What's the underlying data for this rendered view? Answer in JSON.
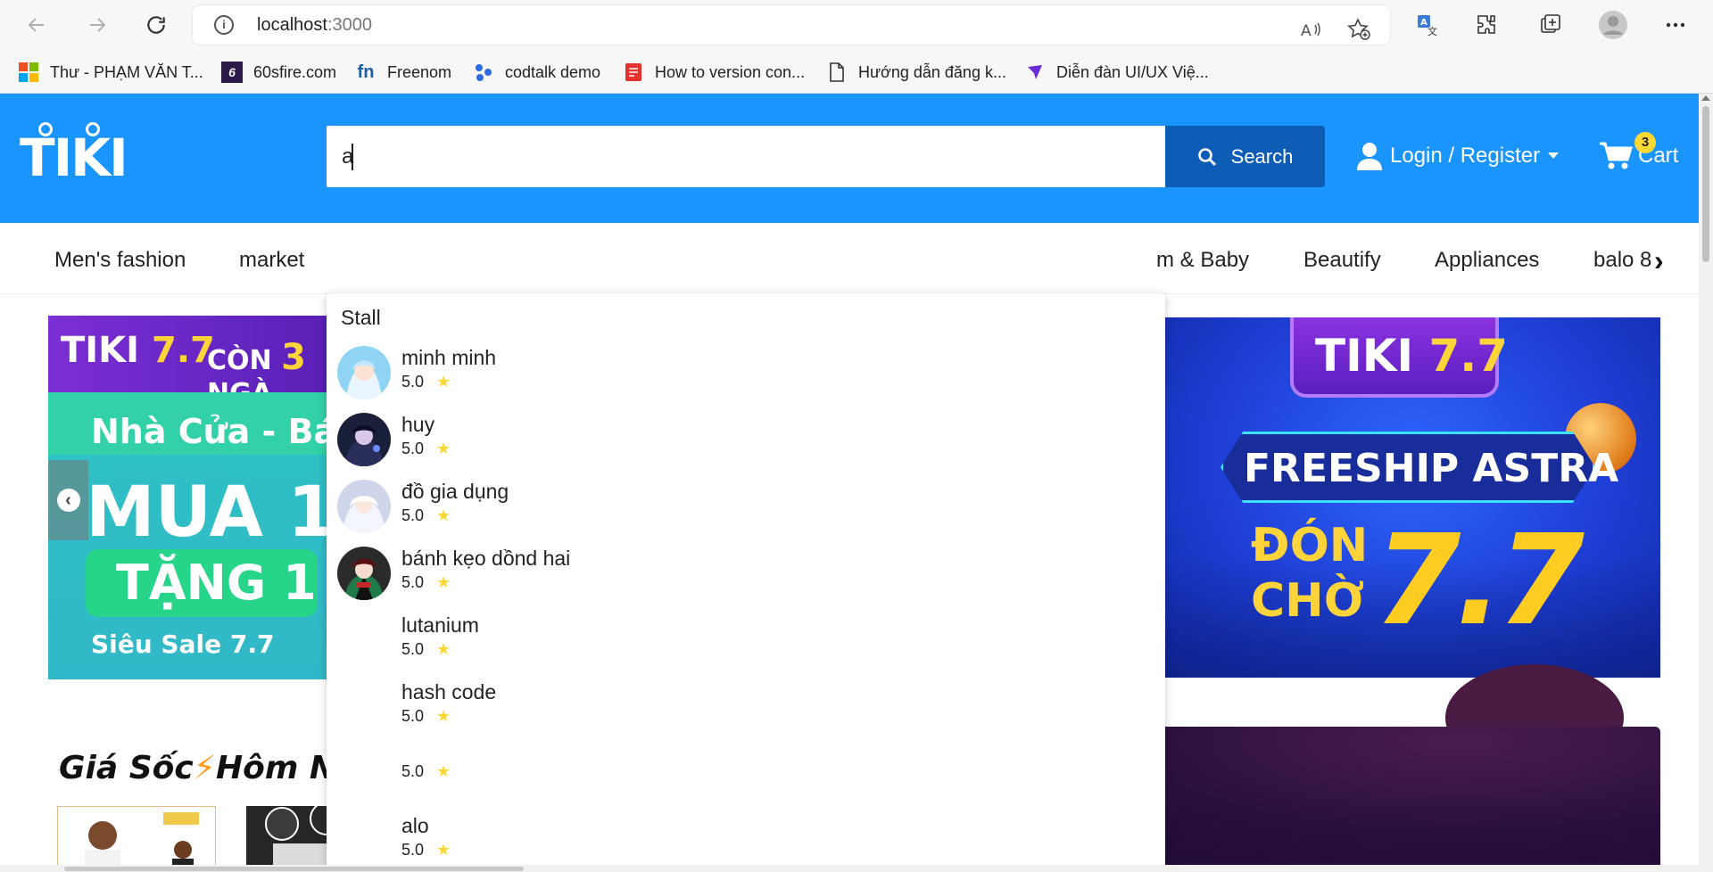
{
  "browser": {
    "url_host": "localhost",
    "url_port": ":3000",
    "icons": [
      "back-icon",
      "forward-icon",
      "refresh-icon",
      "info-icon",
      "read-aloud-icon",
      "add-favorite-icon",
      "translate-icon",
      "extensions-icon",
      "collections-icon",
      "profile-icon",
      "more-icon"
    ],
    "bookmarks": [
      {
        "label": "Thư - PHẠM VĂN T...",
        "icon": "microsoft-icon"
      },
      {
        "label": "60sfire.com",
        "icon": "60sfire-icon"
      },
      {
        "label": "Freenom",
        "icon": "freenom-icon"
      },
      {
        "label": "codtalk demo",
        "icon": "codtalk-icon"
      },
      {
        "label": "How to version con...",
        "icon": "pdf-icon"
      },
      {
        "label": "Hướng dẫn đăng k...",
        "icon": "document-icon"
      },
      {
        "label": "Diễn đàn UI/UX Việ...",
        "icon": "forum-icon"
      }
    ]
  },
  "header": {
    "logo": "TIKI",
    "search_value": "a",
    "search_button": "Search",
    "login_label": "Login / Register",
    "cart_label": "Cart",
    "cart_count": "3",
    "brand_color": "#1a94ff",
    "search_button_color": "#0d5cb6"
  },
  "categories": [
    "Men's fashion",
    "market",
    "m & Baby",
    "Beautify",
    "Appliances",
    "balo 8"
  ],
  "banners": {
    "left": {
      "logo_part1": "TIKI",
      "logo_part2": "7.7",
      "countdown_prefix": "CÒN",
      "countdown_number": "3",
      "countdown_suffix": "NGÀ",
      "line1": "Nhà Cửa - Bách",
      "line2": "MUA 1",
      "line3": "TẶNG 1",
      "line4": "Siêu Sale 7.7"
    },
    "right": {
      "logo_part1": "TIKI",
      "logo_part2": "7.7",
      "ribbon": "FREESHIP ASTRA",
      "line1": "ĐÓN",
      "line2": "CHỜ",
      "big": "7.7"
    }
  },
  "deals": {
    "title_part1": "Giá Sốc",
    "title_bolt": "⚡",
    "title_part2": "Hôm Na"
  },
  "dropdown": {
    "heading": "Stall",
    "items": [
      {
        "name": "minh minh",
        "rating": "5.0",
        "avatar": "anime-girl-blue"
      },
      {
        "name": "huy",
        "rating": "5.0",
        "avatar": "anime-boy-dark"
      },
      {
        "name": "đồ gia dụng",
        "rating": "5.0",
        "avatar": "anime-girl-white"
      },
      {
        "name": "bánh kẹo dồnd hai",
        "rating": "5.0",
        "avatar": "anime-boy-red"
      },
      {
        "name": "lutanium",
        "rating": "5.0",
        "avatar": ""
      },
      {
        "name": "hash code",
        "rating": "5.0",
        "avatar": ""
      },
      {
        "name": "",
        "rating": "5.0",
        "avatar": ""
      },
      {
        "name": "alo",
        "rating": "5.0",
        "avatar": ""
      }
    ]
  }
}
